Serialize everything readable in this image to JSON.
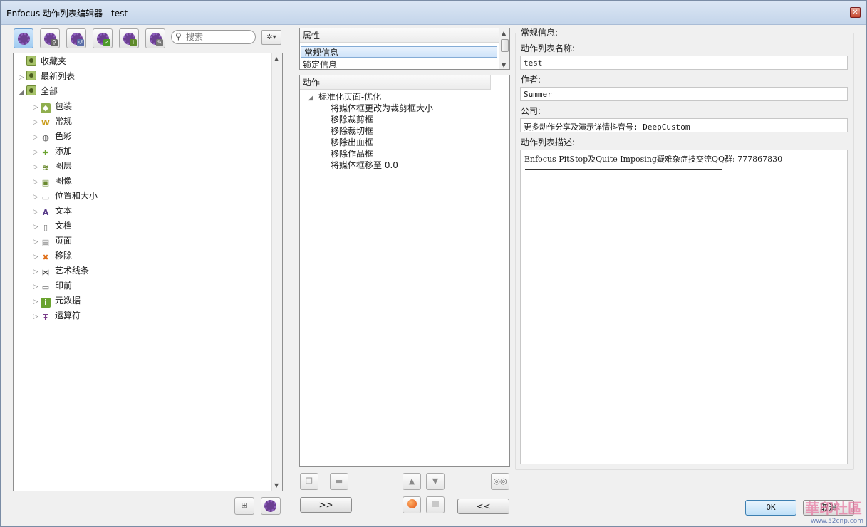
{
  "window": {
    "title": "Enfocus 动作列表编辑器 - test",
    "close_glyph": "✕"
  },
  "search": {
    "placeholder": "搜索"
  },
  "tree": {
    "items": [
      {
        "label": "收藏夹",
        "icon": "folder-icon",
        "level": 0,
        "expander": ""
      },
      {
        "label": "最新列表",
        "icon": "folder-icon",
        "level": 0,
        "expander": "▷"
      },
      {
        "label": "全部",
        "icon": "folder-icon",
        "level": 0,
        "expander": "◢"
      },
      {
        "label": "包装",
        "icon": "package-icon",
        "level": 1,
        "expander": "▷"
      },
      {
        "label": "常规",
        "icon": "crown-icon",
        "level": 1,
        "expander": "▷"
      },
      {
        "label": "色彩",
        "icon": "palette-icon",
        "level": 1,
        "expander": "▷"
      },
      {
        "label": "添加",
        "icon": "plus-icon",
        "level": 1,
        "expander": "▷"
      },
      {
        "label": "图层",
        "icon": "layers-icon",
        "level": 1,
        "expander": "▷"
      },
      {
        "label": "图像",
        "icon": "image-icon",
        "level": 1,
        "expander": "▷"
      },
      {
        "label": "位置和大小",
        "icon": "position-size-icon",
        "level": 1,
        "expander": "▷"
      },
      {
        "label": "文本",
        "icon": "text-icon",
        "level": 1,
        "expander": "▷"
      },
      {
        "label": "文档",
        "icon": "document-icon",
        "level": 1,
        "expander": "▷"
      },
      {
        "label": "页面",
        "icon": "page-icon",
        "level": 1,
        "expander": "▷"
      },
      {
        "label": "移除",
        "icon": "remove-icon",
        "level": 1,
        "expander": "▷"
      },
      {
        "label": "艺术线条",
        "icon": "line-art-icon",
        "level": 1,
        "expander": "▷"
      },
      {
        "label": "印前",
        "icon": "monitor-icon",
        "level": 1,
        "expander": "▷"
      },
      {
        "label": "元数据",
        "icon": "info-icon",
        "level": 1,
        "expander": "▷"
      },
      {
        "label": "运算符",
        "icon": "operator-icon",
        "level": 1,
        "expander": "▷"
      }
    ]
  },
  "properties": {
    "header": "属性",
    "items": [
      "常规信息",
      "锁定信息"
    ],
    "selected_index": 0
  },
  "actions": {
    "header": "动作",
    "group": "标准化页面-优化",
    "group_expander": "◢",
    "items": [
      "将媒体框更改为裁剪框大小",
      "移除裁剪框",
      "移除裁切框",
      "移除出血框",
      "移除作品框",
      "将媒体框移至 0.0"
    ]
  },
  "general": {
    "section_title": "常规信息:",
    "name_label": "动作列表名称:",
    "name_value": "test",
    "author_label": "作者:",
    "author_value": "Summer",
    "company_label": "公司:",
    "company_value": "更多动作分享及演示详情抖音号: DeepCustom",
    "description_label": "动作列表描述:",
    "description_value": "Enfocus PitStop及Quite Imposing疑难杂症技交流QQ群: 777867830"
  },
  "buttons": {
    "add_right": ">>",
    "remove_left": "<<",
    "ok": "OK",
    "cancel": "取消"
  },
  "watermark": {
    "big": "華印社區",
    "url": "www.52cnp.com"
  },
  "colors": {
    "accent": "#6b3f91",
    "selection": "#cfe3f9",
    "titlebar": "#c4d5ea"
  }
}
